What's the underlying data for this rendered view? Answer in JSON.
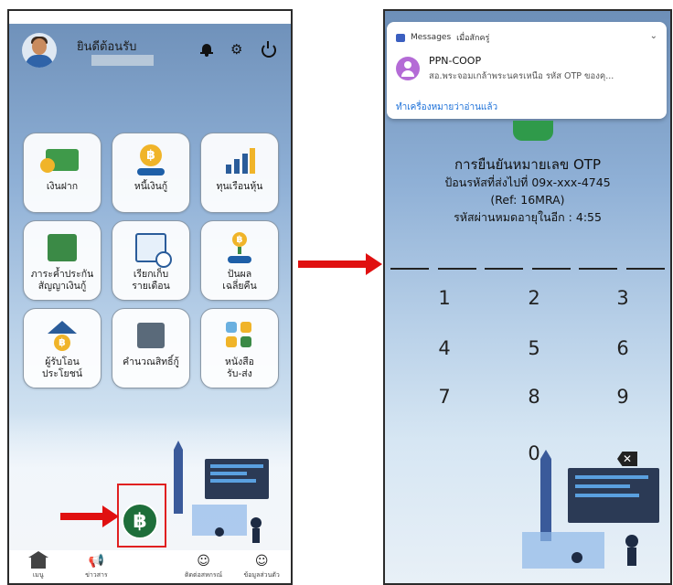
{
  "left_phone": {
    "header": {
      "welcome_text": "ยินดีต้อนรับ",
      "icons": [
        "bell-icon",
        "gear-icon",
        "power-icon"
      ]
    },
    "menu_tiles": [
      {
        "label": "เงินฝาก",
        "icon": "money-icon"
      },
      {
        "label": "หนี้เงินกู้",
        "icon": "coin-hand-icon"
      },
      {
        "label": "ทุนเรือนหุ้น",
        "icon": "growth-chart-icon"
      },
      {
        "label": "ภาระค้ำประกัน\nสัญญาเงินกู้",
        "icon": "bank-box-icon"
      },
      {
        "label": "เรียกเก็บ\nรายเดือน",
        "icon": "calendar-clock-icon"
      },
      {
        "label": "ปันผล\nเฉลี่ยคืน",
        "icon": "plant-coin-icon"
      },
      {
        "label": "ผู้รับโอน\nประโยชน์",
        "icon": "house-coin-icon"
      },
      {
        "label": "คำนวณสิทธิ์กู้",
        "icon": "calculator-icon"
      },
      {
        "label": "หนังสือ\nรับ-ส่ง",
        "icon": "documents-icon"
      }
    ],
    "bottom_nav": [
      {
        "label": "เมนู",
        "icon": "home-icon"
      },
      {
        "label": "ข่าวสาร",
        "icon": "megaphone-icon"
      },
      {
        "label": "ติดต่อสหกรณ์",
        "icon": "contact-icon"
      },
      {
        "label": "ข้อมูลส่วนตัว",
        "icon": "profile-icon"
      }
    ],
    "fab_symbol": "฿",
    "highlight_color": "#e02020"
  },
  "right_phone": {
    "notification": {
      "app_name": "Messages",
      "time": "เมื่อสักครู่",
      "sender": "PPN-COOP",
      "preview": "สอ.พระจอมเกล้าพระนครเหนือ รหัส OTP ของคุ...",
      "action": "ทำเครื่องหมายว่าอ่านแล้ว"
    },
    "otp": {
      "title": "การยืนยันหมายเลข OTP",
      "sent_to": "ป้อนรหัสที่ส่งไปที่ 09x-xxx-4745",
      "ref": "(Ref: 16MRA)",
      "expiry": "รหัสผ่านหมดอายุในอีก :  4:55"
    },
    "keypad": [
      "1",
      "2",
      "3",
      "4",
      "5",
      "6",
      "7",
      "8",
      "9",
      "0"
    ],
    "otp_digit_slots": 6,
    "accent_color": "#2f9a4a"
  }
}
